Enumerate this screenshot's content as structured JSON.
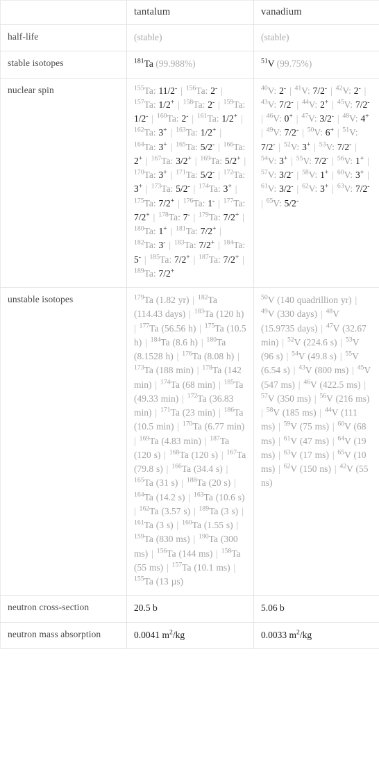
{
  "table": {
    "columns": [
      "",
      "tantalum",
      "vanadium"
    ],
    "rows": [
      {
        "label": "half-life",
        "tantalum": "(stable)",
        "vanadium": "(stable)",
        "style": "dim"
      },
      {
        "label": "stable isotopes",
        "tantalum_isotope": "181",
        "tantalum_symbol": "Ta",
        "tantalum_abundance": "(99.988%)",
        "vanadium_isotope": "51",
        "vanadium_symbol": "V",
        "vanadium_abundance": "(99.75%)",
        "style": "isotope"
      },
      {
        "label": "nuclear spin",
        "style": "nuclide-list"
      },
      {
        "label": "unstable isotopes",
        "style": "nuclide-list"
      },
      {
        "label": "neutron cross-section",
        "tantalum": "20.5 b",
        "vanadium": "5.06 b",
        "style": "plain"
      },
      {
        "label": "neutron mass absorption",
        "tantalum_value": "0.0041 m",
        "tantalum_unit_sup": "2",
        "tantalum_unit_tail": "/kg",
        "vanadium_value": "0.0033 m",
        "vanadium_unit_sup": "2",
        "vanadium_unit_tail": "/kg",
        "style": "unit"
      }
    ]
  },
  "nuclear_spin": {
    "tantalum": [
      {
        "mass": "155",
        "sym": "Ta",
        "spin": "11/2",
        "charge": "-"
      },
      {
        "mass": "156",
        "sym": "Ta",
        "spin": "2",
        "charge": "-"
      },
      {
        "mass": "157",
        "sym": "Ta",
        "spin": "1/2",
        "charge": "+"
      },
      {
        "mass": "158",
        "sym": "Ta",
        "spin": "2",
        "charge": "-"
      },
      {
        "mass": "159",
        "sym": "Ta",
        "spin": "1/2",
        "charge": "-"
      },
      {
        "mass": "160",
        "sym": "Ta",
        "spin": "2",
        "charge": "-"
      },
      {
        "mass": "161",
        "sym": "Ta",
        "spin": "1/2",
        "charge": "+"
      },
      {
        "mass": "162",
        "sym": "Ta",
        "spin": "3",
        "charge": "+"
      },
      {
        "mass": "163",
        "sym": "Ta",
        "spin": "1/2",
        "charge": "+"
      },
      {
        "mass": "164",
        "sym": "Ta",
        "spin": "3",
        "charge": "+"
      },
      {
        "mass": "165",
        "sym": "Ta",
        "spin": "5/2",
        "charge": "-"
      },
      {
        "mass": "166",
        "sym": "Ta",
        "spin": "2",
        "charge": "+"
      },
      {
        "mass": "167",
        "sym": "Ta",
        "spin": "3/2",
        "charge": "+"
      },
      {
        "mass": "169",
        "sym": "Ta",
        "spin": "5/2",
        "charge": "+"
      },
      {
        "mass": "170",
        "sym": "Ta",
        "spin": "3",
        "charge": "+"
      },
      {
        "mass": "171",
        "sym": "Ta",
        "spin": "5/2",
        "charge": "-"
      },
      {
        "mass": "172",
        "sym": "Ta",
        "spin": "3",
        "charge": "+"
      },
      {
        "mass": "173",
        "sym": "Ta",
        "spin": "5/2",
        "charge": "-"
      },
      {
        "mass": "174",
        "sym": "Ta",
        "spin": "3",
        "charge": "+"
      },
      {
        "mass": "175",
        "sym": "Ta",
        "spin": "7/2",
        "charge": "+"
      },
      {
        "mass": "176",
        "sym": "Ta",
        "spin": "1",
        "charge": "-"
      },
      {
        "mass": "177",
        "sym": "Ta",
        "spin": "7/2",
        "charge": "+"
      },
      {
        "mass": "178",
        "sym": "Ta",
        "spin": "7",
        "charge": "-"
      },
      {
        "mass": "179",
        "sym": "Ta",
        "spin": "7/2",
        "charge": "+"
      },
      {
        "mass": "180",
        "sym": "Ta",
        "spin": "1",
        "charge": "+"
      },
      {
        "mass": "181",
        "sym": "Ta",
        "spin": "7/2",
        "charge": "+"
      },
      {
        "mass": "182",
        "sym": "Ta",
        "spin": "3",
        "charge": "-"
      },
      {
        "mass": "183",
        "sym": "Ta",
        "spin": "7/2",
        "charge": "+"
      },
      {
        "mass": "184",
        "sym": "Ta",
        "spin": "5",
        "charge": "-"
      },
      {
        "mass": "185",
        "sym": "Ta",
        "spin": "7/2",
        "charge": "+"
      },
      {
        "mass": "187",
        "sym": "Ta",
        "spin": "7/2",
        "charge": "+"
      },
      {
        "mass": "189",
        "sym": "Ta",
        "spin": "7/2",
        "charge": "+"
      }
    ],
    "vanadium": [
      {
        "mass": "40",
        "sym": "V",
        "spin": "2",
        "charge": "-"
      },
      {
        "mass": "41",
        "sym": "V",
        "spin": "7/2",
        "charge": "-"
      },
      {
        "mass": "42",
        "sym": "V",
        "spin": "2",
        "charge": "-"
      },
      {
        "mass": "43",
        "sym": "V",
        "spin": "7/2",
        "charge": "-"
      },
      {
        "mass": "44",
        "sym": "V",
        "spin": "2",
        "charge": "+"
      },
      {
        "mass": "45",
        "sym": "V",
        "spin": "7/2",
        "charge": "-"
      },
      {
        "mass": "46",
        "sym": "V",
        "spin": "0",
        "charge": "+"
      },
      {
        "mass": "47",
        "sym": "V",
        "spin": "3/2",
        "charge": "-"
      },
      {
        "mass": "48",
        "sym": "V",
        "spin": "4",
        "charge": "+"
      },
      {
        "mass": "49",
        "sym": "V",
        "spin": "7/2",
        "charge": "-"
      },
      {
        "mass": "50",
        "sym": "V",
        "spin": "6",
        "charge": "+"
      },
      {
        "mass": "51",
        "sym": "V",
        "spin": "7/2",
        "charge": "-"
      },
      {
        "mass": "52",
        "sym": "V",
        "spin": "3",
        "charge": "+"
      },
      {
        "mass": "53",
        "sym": "V",
        "spin": "7/2",
        "charge": "-"
      },
      {
        "mass": "54",
        "sym": "V",
        "spin": "3",
        "charge": "+"
      },
      {
        "mass": "55",
        "sym": "V",
        "spin": "7/2",
        "charge": "-"
      },
      {
        "mass": "56",
        "sym": "V",
        "spin": "1",
        "charge": "+"
      },
      {
        "mass": "57",
        "sym": "V",
        "spin": "3/2",
        "charge": "-"
      },
      {
        "mass": "58",
        "sym": "V",
        "spin": "1",
        "charge": "+"
      },
      {
        "mass": "60",
        "sym": "V",
        "spin": "3",
        "charge": "+"
      },
      {
        "mass": "61",
        "sym": "V",
        "spin": "3/2",
        "charge": "-"
      },
      {
        "mass": "62",
        "sym": "V",
        "spin": "3",
        "charge": "+"
      },
      {
        "mass": "63",
        "sym": "V",
        "spin": "7/2",
        "charge": "-"
      },
      {
        "mass": "65",
        "sym": "V",
        "spin": "5/2",
        "charge": "-"
      }
    ]
  },
  "unstable_isotopes": {
    "tantalum": [
      {
        "mass": "179",
        "sym": "Ta",
        "halflife": "(1.82 yr)"
      },
      {
        "mass": "182",
        "sym": "Ta",
        "halflife": "(114.43 days)"
      },
      {
        "mass": "183",
        "sym": "Ta",
        "halflife": "(120 h)"
      },
      {
        "mass": "177",
        "sym": "Ta",
        "halflife": "(56.56 h)"
      },
      {
        "mass": "175",
        "sym": "Ta",
        "halflife": "(10.5 h)"
      },
      {
        "mass": "184",
        "sym": "Ta",
        "halflife": "(8.6 h)"
      },
      {
        "mass": "180",
        "sym": "Ta",
        "halflife": "(8.1528 h)"
      },
      {
        "mass": "176",
        "sym": "Ta",
        "halflife": "(8.08 h)"
      },
      {
        "mass": "173",
        "sym": "Ta",
        "halflife": "(188 min)"
      },
      {
        "mass": "178",
        "sym": "Ta",
        "halflife": "(142 min)"
      },
      {
        "mass": "174",
        "sym": "Ta",
        "halflife": "(68 min)"
      },
      {
        "mass": "185",
        "sym": "Ta",
        "halflife": "(49.33 min)"
      },
      {
        "mass": "172",
        "sym": "Ta",
        "halflife": "(36.83 min)"
      },
      {
        "mass": "171",
        "sym": "Ta",
        "halflife": "(23 min)"
      },
      {
        "mass": "186",
        "sym": "Ta",
        "halflife": "(10.5 min)"
      },
      {
        "mass": "170",
        "sym": "Ta",
        "halflife": "(6.77 min)"
      },
      {
        "mass": "169",
        "sym": "Ta",
        "halflife": "(4.83 min)"
      },
      {
        "mass": "187",
        "sym": "Ta",
        "halflife": "(120 s)"
      },
      {
        "mass": "168",
        "sym": "Ta",
        "halflife": "(120 s)"
      },
      {
        "mass": "167",
        "sym": "Ta",
        "halflife": "(79.8 s)"
      },
      {
        "mass": "166",
        "sym": "Ta",
        "halflife": "(34.4 s)"
      },
      {
        "mass": "165",
        "sym": "Ta",
        "halflife": "(31 s)"
      },
      {
        "mass": "188",
        "sym": "Ta",
        "halflife": "(20 s)"
      },
      {
        "mass": "164",
        "sym": "Ta",
        "halflife": "(14.2 s)"
      },
      {
        "mass": "163",
        "sym": "Ta",
        "halflife": "(10.6 s)"
      },
      {
        "mass": "162",
        "sym": "Ta",
        "halflife": "(3.57 s)"
      },
      {
        "mass": "189",
        "sym": "Ta",
        "halflife": "(3 s)"
      },
      {
        "mass": "161",
        "sym": "Ta",
        "halflife": "(3 s)"
      },
      {
        "mass": "160",
        "sym": "Ta",
        "halflife": "(1.55 s)"
      },
      {
        "mass": "159",
        "sym": "Ta",
        "halflife": "(830 ms)"
      },
      {
        "mass": "190",
        "sym": "Ta",
        "halflife": "(300 ms)"
      },
      {
        "mass": "156",
        "sym": "Ta",
        "halflife": "(144 ms)"
      },
      {
        "mass": "158",
        "sym": "Ta",
        "halflife": "(55 ms)"
      },
      {
        "mass": "157",
        "sym": "Ta",
        "halflife": "(10.1 ms)"
      },
      {
        "mass": "155",
        "sym": "Ta",
        "halflife": "(13 µs)"
      }
    ],
    "vanadium": [
      {
        "mass": "50",
        "sym": "V",
        "halflife": "(140 quadrillion yr)"
      },
      {
        "mass": "49",
        "sym": "V",
        "halflife": "(330 days)"
      },
      {
        "mass": "48",
        "sym": "V",
        "halflife": "(15.9735 days)"
      },
      {
        "mass": "47",
        "sym": "V",
        "halflife": "(32.67 min)"
      },
      {
        "mass": "52",
        "sym": "V",
        "halflife": "(224.6 s)"
      },
      {
        "mass": "53",
        "sym": "V",
        "halflife": "(96 s)"
      },
      {
        "mass": "54",
        "sym": "V",
        "halflife": "(49.8 s)"
      },
      {
        "mass": "55",
        "sym": "V",
        "halflife": "(6.54 s)"
      },
      {
        "mass": "43",
        "sym": "V",
        "halflife": "(800 ms)"
      },
      {
        "mass": "45",
        "sym": "V",
        "halflife": "(547 ms)"
      },
      {
        "mass": "46",
        "sym": "V",
        "halflife": "(422.5 ms)"
      },
      {
        "mass": "57",
        "sym": "V",
        "halflife": "(350 ms)"
      },
      {
        "mass": "56",
        "sym": "V",
        "halflife": "(216 ms)"
      },
      {
        "mass": "58",
        "sym": "V",
        "halflife": "(185 ms)"
      },
      {
        "mass": "44",
        "sym": "V",
        "halflife": "(111 ms)"
      },
      {
        "mass": "59",
        "sym": "V",
        "halflife": "(75 ms)"
      },
      {
        "mass": "60",
        "sym": "V",
        "halflife": "(68 ms)"
      },
      {
        "mass": "61",
        "sym": "V",
        "halflife": "(47 ms)"
      },
      {
        "mass": "64",
        "sym": "V",
        "halflife": "(19 ms)"
      },
      {
        "mass": "63",
        "sym": "V",
        "halflife": "(17 ms)"
      },
      {
        "mass": "65",
        "sym": "V",
        "halflife": "(10 ms)"
      },
      {
        "mass": "62",
        "sym": "V",
        "halflife": "(150 ns)"
      },
      {
        "mass": "42",
        "sym": "V",
        "halflife": "(55 ns)"
      }
    ]
  },
  "colors": {
    "border": "#e4e4e4",
    "label_text": "#4a4a4a",
    "value_text": "#1e1e1e",
    "muted_text": "#a9a9a9",
    "background": "#ffffff"
  }
}
